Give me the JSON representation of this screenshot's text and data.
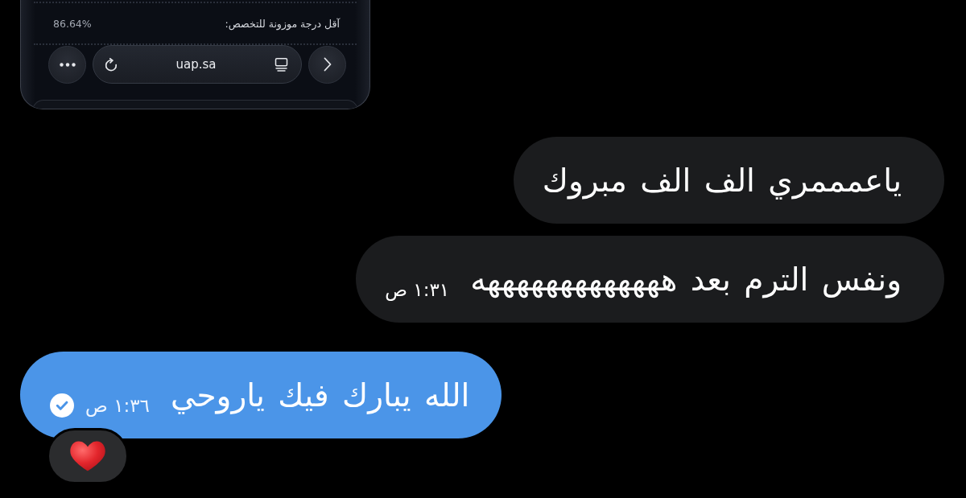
{
  "shared_screenshot": {
    "score_label": "آقل درجة موزونة للتخصص:",
    "score_value": "86.64%",
    "browser_bar": {
      "url": "uap.sa"
    }
  },
  "messages": [
    {
      "kind": "received",
      "text": "ياعمممري الف الف مبروك"
    },
    {
      "kind": "received",
      "text": "ونفس الترم بعد هههههههههههههه",
      "time": "١:٣١ ص"
    },
    {
      "kind": "sent",
      "text": "الله يبارك فيك ياروحي",
      "time": "١:٣٦ ص",
      "read": true,
      "reaction": {
        "kind": "heart"
      }
    }
  ]
}
